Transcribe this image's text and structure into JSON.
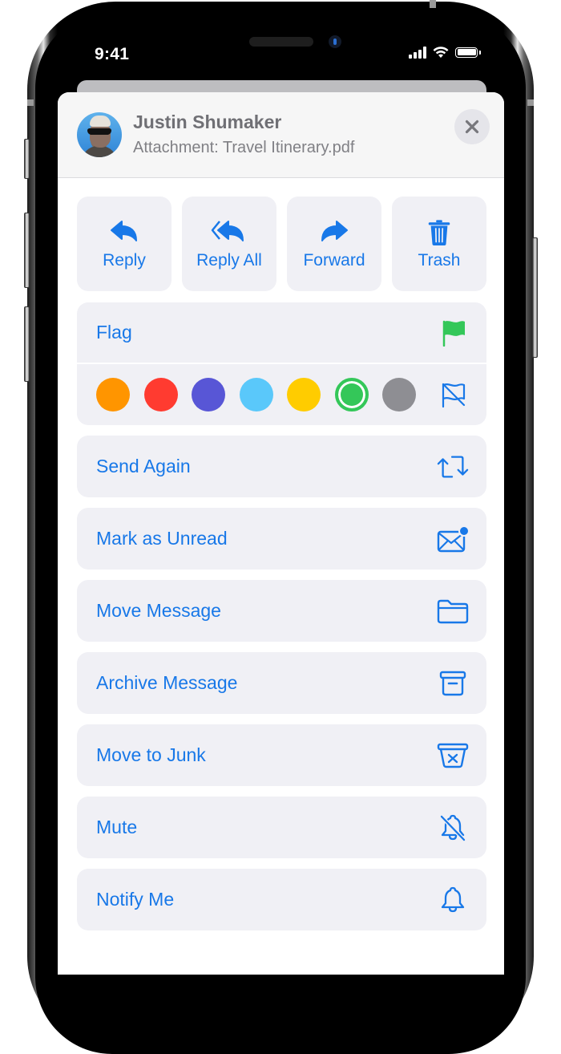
{
  "status_bar": {
    "time": "9:41",
    "signal_bars": 4,
    "wifi": "wifi-icon",
    "battery_level": 1.0
  },
  "header": {
    "sender": "Justin Shumaker",
    "subject": "Attachment: Travel Itinerary.pdf",
    "avatar": "avatar-photo",
    "close_icon": "close-icon"
  },
  "actions": [
    {
      "label": "Reply",
      "icon": "reply-icon"
    },
    {
      "label": "Reply All",
      "icon": "reply-all-icon"
    },
    {
      "label": "Forward",
      "icon": "forward-icon"
    },
    {
      "label": "Trash",
      "icon": "trash-icon"
    }
  ],
  "flag": {
    "label": "Flag",
    "icon": "flag-icon",
    "flag_color": "#34c759",
    "colors": [
      {
        "name": "orange",
        "hex": "#ff9500",
        "selected": false
      },
      {
        "name": "red",
        "hex": "#ff3b30",
        "selected": false
      },
      {
        "name": "purple",
        "hex": "#5856d6",
        "selected": false
      },
      {
        "name": "blue",
        "hex": "#5ac8fa",
        "selected": false
      },
      {
        "name": "yellow",
        "hex": "#ffcc00",
        "selected": false
      },
      {
        "name": "green",
        "hex": "#34c759",
        "selected": true
      },
      {
        "name": "gray",
        "hex": "#8e8e93",
        "selected": false
      }
    ],
    "unflag_icon": "unflag-icon"
  },
  "menu": [
    {
      "label": "Send Again",
      "icon": "send-again-icon"
    },
    {
      "label": "Mark as Unread",
      "icon": "mark-unread-icon"
    },
    {
      "label": "Move Message",
      "icon": "folder-icon"
    },
    {
      "label": "Archive Message",
      "icon": "archive-icon"
    },
    {
      "label": "Move to Junk",
      "icon": "junk-icon"
    },
    {
      "label": "Mute",
      "icon": "bell-slash-icon"
    },
    {
      "label": "Notify Me",
      "icon": "bell-icon"
    }
  ],
  "colors": {
    "accent": "#1878e8",
    "tile_bg": "#f0f0f5",
    "header_bg": "#f6f6f6"
  }
}
